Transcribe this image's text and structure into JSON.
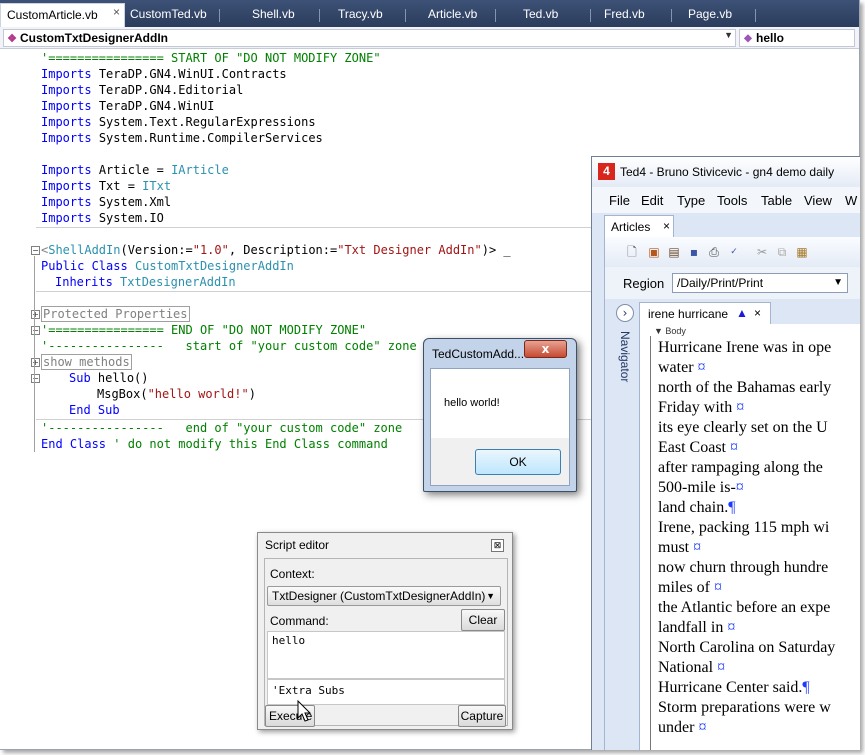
{
  "ide": {
    "tabs": [
      "CustomArticle.vb",
      "CustomTed.vb",
      "Shell.vb",
      "Tracy.vb",
      "Article.vb",
      "Ted.vb",
      "Fred.vb",
      "Page.vb"
    ],
    "tab_close": "×",
    "class_combo": "CustomTxtDesignerAddIn",
    "member_combo": "hello",
    "code": {
      "l1": "'================ START OF \"DO NOT MODIFY ZONE\"",
      "imports_kw": "Imports",
      "i1": "TeraDP.GN4.WinUI.Contracts",
      "i2": "TeraDP.GN4.Editorial",
      "i3": "TeraDP.GN4.WinUI",
      "i4": "System.Text.RegularExpressions",
      "i5": "System.Runtime.CompilerServices",
      "a1_left": "Article = ",
      "a1_type": "IArticle",
      "a2_left": "Txt = ",
      "a2_type": "ITxt",
      "i6": "System.Xml",
      "i7": "System.IO",
      "attr_open": "<",
      "attr_name": "ShellAddIn",
      "attr_args1": "(Version:=",
      "attr_v1": "\"1.0\"",
      "attr_args2": ", Description:=",
      "attr_v2": "\"Txt Designer AddIn\"",
      "attr_close": ")> _",
      "public_class_kw": "Public Class",
      "class_name": "CustomTxtDesignerAddIn",
      "inherits_kw": "Inherits",
      "inherits_type": "TxtDesignerAddIn",
      "region_props": "Protected Properties",
      "end_zone": "'================ END OF \"DO NOT MODIFY ZONE\"",
      "start_custom": "'----------------   start of \"your custom code\" zone",
      "region_methods": "show methods",
      "sub_kw": "Sub",
      "sub_name": "hello()",
      "msgbox": "MsgBox(",
      "msgbox_arg": "\"hello world!\"",
      "msgbox_close": ")",
      "end_sub": "End Sub",
      "end_custom": "'----------------   end of \"your custom code\" zone",
      "end_class_kw": "End Class",
      "end_class_comment": "' do not modify this End Class command"
    }
  },
  "ted": {
    "title": "Ted4 - Bruno Stivicevic - gn4 demo daily",
    "app_icon": "4",
    "menu": [
      "File",
      "Edit",
      "Type",
      "Tools",
      "Table",
      "View",
      "W"
    ],
    "articles_tab": "Articles",
    "region_label": "Region",
    "region_value": "/Daily/Print/Print",
    "navigator_label": "Navigator",
    "doc_tab": "irene hurricane",
    "body_label": "Body",
    "doc_lines": [
      [
        "Hurricane Irene was in ope",
        ""
      ],
      [
        "water ",
        "¤"
      ],
      [
        "north of the Bahamas early",
        ""
      ],
      [
        "Friday with ",
        "¤"
      ],
      [
        "its eye clearly set on the U",
        ""
      ],
      [
        "East Coast ",
        "¤"
      ],
      [
        "after rampaging along the",
        ""
      ],
      [
        "500-mile is-",
        "¤"
      ],
      [
        "land chain.",
        "¶"
      ],
      [
        "Irene, packing 115 mph wi",
        ""
      ],
      [
        "must ",
        "¤"
      ],
      [
        "now churn through hundre",
        ""
      ],
      [
        "miles of ",
        "¤"
      ],
      [
        "the Atlantic before an expe",
        ""
      ],
      [
        "landfall in ",
        "¤"
      ],
      [
        "North Carolina on Saturday",
        ""
      ],
      [
        "National ",
        "¤"
      ],
      [
        "Hurricane Center said.",
        "¶"
      ],
      [
        "Storm preparations were w",
        ""
      ],
      [
        "under ",
        "¤"
      ]
    ]
  },
  "msgbox": {
    "title": "TedCustomAdd...",
    "close": "x",
    "text": "hello world!",
    "ok": "OK"
  },
  "script_editor": {
    "title": "Script editor",
    "close": "⊠",
    "context_label": "Context:",
    "context_value": "TxtDesigner (CustomTxtDesignerAddIn)",
    "command_label": "Command:",
    "clear": "Clear",
    "command_text": "hello",
    "output_text": "'Extra Subs",
    "execute": "Execute",
    "capture": "Capture"
  }
}
